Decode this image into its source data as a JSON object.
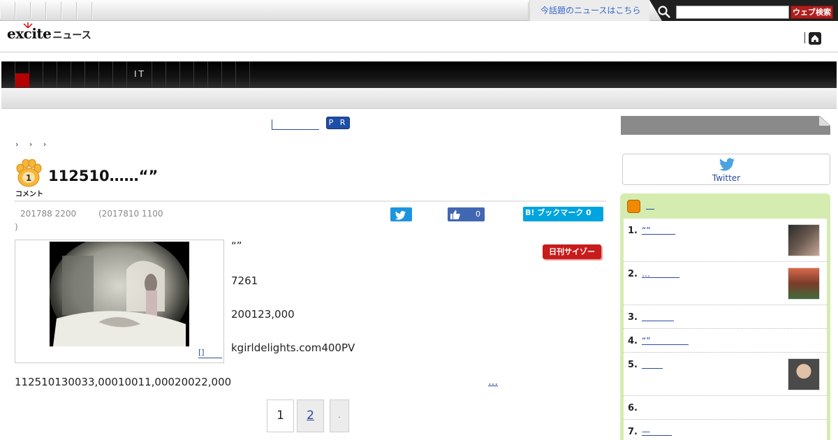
{
  "topbar": {
    "news_link": "今話題のニュースはこちら",
    "search_button": "ウェブ検索",
    "search_placeholder": ""
  },
  "header": {
    "logo_text": "excite",
    "logo_sub": "ニュース"
  },
  "nav": {
    "label": "IT"
  },
  "pr": {
    "badge": "P R"
  },
  "breadcrumb": [
    "›",
    "›",
    "›"
  ],
  "article": {
    "comment_count": "1",
    "comment_label": "コメント",
    "title": "112510……“”",
    "published": "201788 2200",
    "updated": "(2017810 1100",
    "updated_close": ")",
    "source": "日刊サイゾー",
    "photo_caption": "[]",
    "paragraphs": [
      "“”",
      "7261",
      "200123,000",
      "kgirldelights.com400PV"
    ],
    "last_paragraph": "112510130033,00010011,00020022,000",
    "more": "…"
  },
  "share": {
    "fb_count": "0",
    "hatena_label": "B! ブックマーク 0"
  },
  "pagination": {
    "current": "1",
    "next_page": "2",
    "next": "."
  },
  "sidebar": {
    "twitter_label": "Twitter",
    "ranking_head": "",
    "ranking": [
      {
        "num": "1.",
        "title": "“”",
        "has_thumb": true
      },
      {
        "num": "2.",
        "title": "…",
        "has_thumb": true
      },
      {
        "num": "3.",
        "title": "",
        "has_thumb": false
      },
      {
        "num": "4.",
        "title": "“”",
        "has_thumb": false
      },
      {
        "num": "5.",
        "title": "",
        "has_thumb": true
      },
      {
        "num": "6.",
        "title": "",
        "has_thumb": false
      },
      {
        "num": "7.",
        "title": "—",
        "has_thumb": false
      }
    ]
  },
  "colors": {
    "accent_red": "#b30000",
    "link_blue": "#2a4aa0",
    "twitter_blue": "#1b95e0",
    "facebook_blue": "#4267b2",
    "hatena_blue": "#00a4de",
    "ranking_green": "#d4ecb0"
  }
}
